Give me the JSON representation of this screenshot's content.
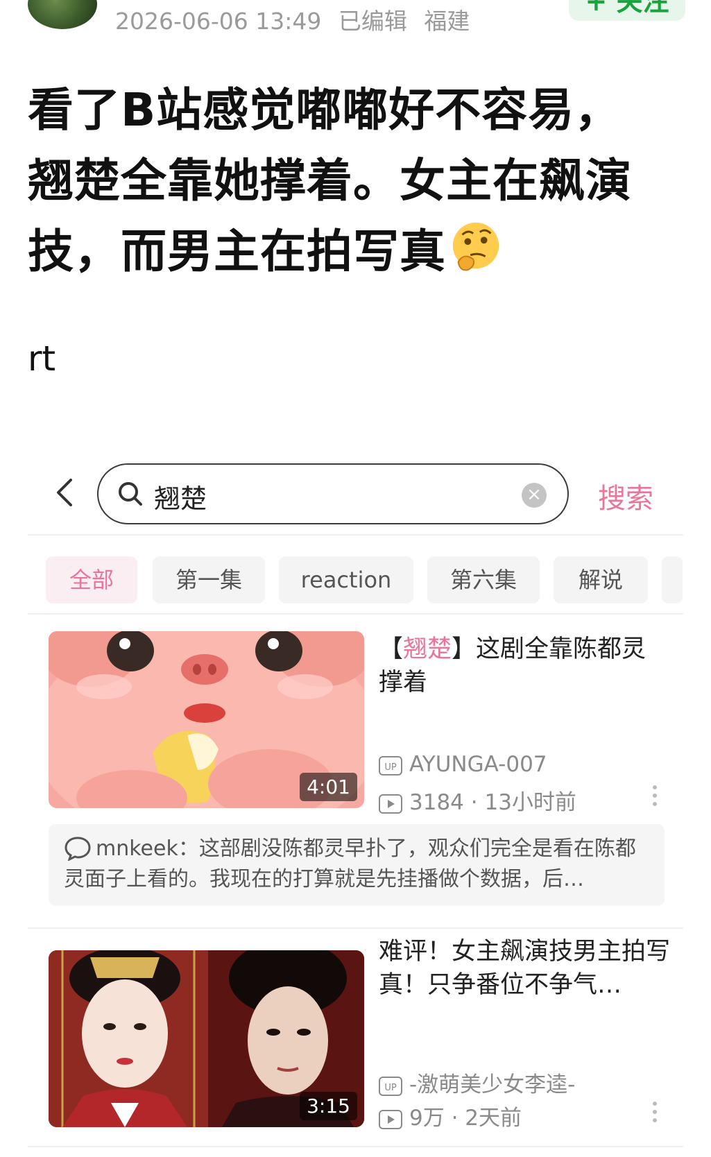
{
  "post": {
    "timestamp": "2026-06-06 13:49",
    "edited_label": "已编辑",
    "location": "福建",
    "follow_label": "+ 关注",
    "title_lines": [
      "看了B站感觉嘟嘟好不容易，",
      "翘楚全靠她撑着。女主在飙演",
      "技，而男主在拍写真"
    ],
    "body": "rt"
  },
  "embedded_screenshot": {
    "search": {
      "query": "翘楚",
      "button_label": "搜索"
    },
    "tabs": [
      "全部",
      "第一集",
      "reaction",
      "第六集",
      "解说"
    ],
    "videos": [
      {
        "title_highlight": "翘楚",
        "title_prefix": "【",
        "title_bracket_close": "】",
        "title_rest": "这剧全靠陈都灵撑着",
        "duration": "4:01",
        "uploader": "AYUNGA-007",
        "views": "3184",
        "time": "13小时前",
        "comment": {
          "user": "mnkeek",
          "text": "：这部剧没陈都灵早扑了，观众们完全是看在陈都灵面子上看的。我现在的打算就是先挂播做个数据，后…"
        }
      },
      {
        "title": "难评！女主飙演技男主拍写真！只争番位不争气…",
        "duration": "3:15",
        "uploader": "-激萌美少女李逵-",
        "views": "9万",
        "time": "2天前"
      }
    ]
  },
  "colors": {
    "accent_pink": "#e8769a",
    "follow_green": "#1aa33c"
  }
}
